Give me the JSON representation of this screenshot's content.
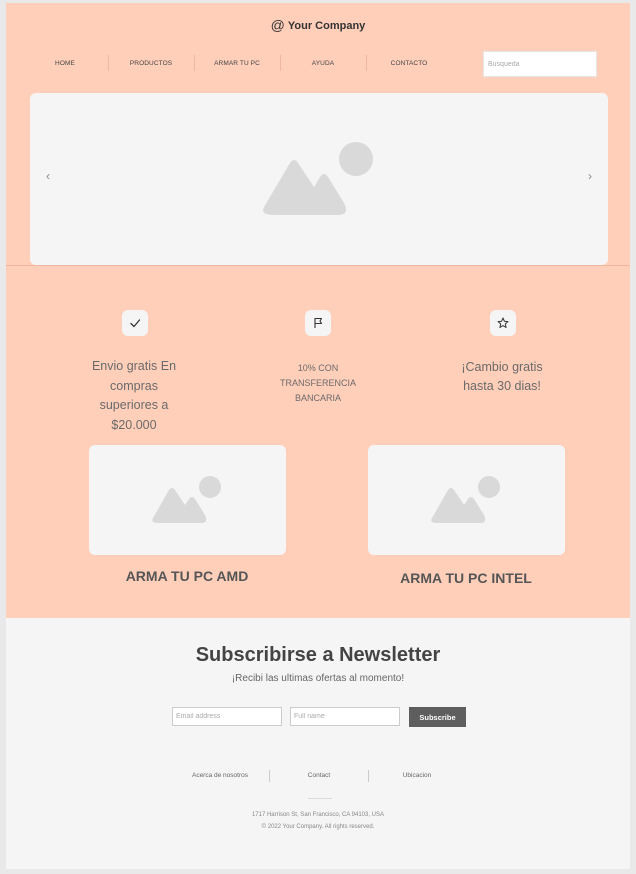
{
  "header": {
    "at_symbol": "@",
    "brand": "Your Company"
  },
  "nav": {
    "items": [
      {
        "label": "HOME"
      },
      {
        "label": "PRODUCTOS"
      },
      {
        "label": "ARMAR TU PC"
      },
      {
        "label": "AYUDA"
      },
      {
        "label": "CONTACTO"
      }
    ],
    "search_placeholder": "Busqueda"
  },
  "hero": {
    "prev": "‹",
    "next": "›"
  },
  "features": [
    {
      "icon": "check-icon",
      "text": "Envio gratis En compras superiores a $20.000"
    },
    {
      "icon": "flag-icon",
      "text": "10% CON TRANSFERENCIA BANCARIA"
    },
    {
      "icon": "star-icon",
      "text": "¡Cambio gratis hasta 30 dias!"
    }
  ],
  "products": [
    {
      "title": "ARMA TU PC AMD"
    },
    {
      "title": "ARMA TU PC INTEL"
    }
  ],
  "newsletter": {
    "title": "Subscribirse a Newsletter",
    "subtitle": "¡Recibi las ultimas ofertas al momento!",
    "email_placeholder": "Email address",
    "name_placeholder": "Full name",
    "button": "Subscribe"
  },
  "footer": {
    "links": [
      {
        "label": "Acerca de nosotros"
      },
      {
        "label": "Contact"
      },
      {
        "label": "Ubicacion"
      }
    ],
    "address": "1717 Harrison St, San Francisco, CA 94103, USA",
    "copyright": "© 2022 Your Company.  All rights reserved."
  },
  "colors": {
    "peach": "#ffcfba",
    "light": "#f5f5f5",
    "button": "#5e5e5e"
  }
}
